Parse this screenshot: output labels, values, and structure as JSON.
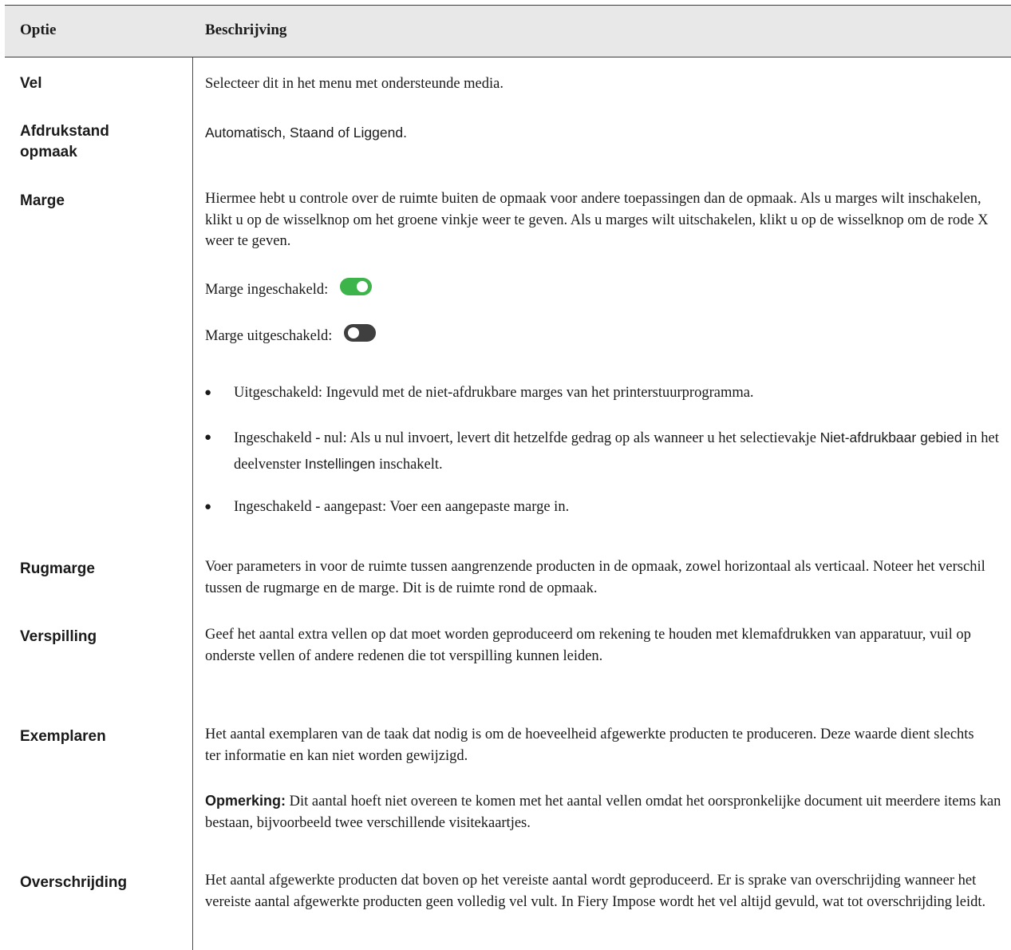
{
  "header": {
    "option": "Optie",
    "description": "Beschrijving"
  },
  "rows": {
    "vel": {
      "option": "Vel",
      "desc": "Selecteer dit in het menu met ondersteunde media."
    },
    "afdrukstand": {
      "option_line1": "Afdrukstand",
      "option_line2": "opmaak",
      "desc": "Automatisch, Staand of Liggend."
    },
    "marge": {
      "option": "Marge",
      "desc": "Hiermee hebt u controle over de ruimte buiten de opmaak voor andere toepassingen dan de opmaak. Als u marges wilt inschakelen, klikt u op de wisselknop om het groene vinkje weer te geven. Als u marges wilt uitschakelen, klikt u op de wisselknop om de rode X weer te geven.",
      "enabled_label": "Marge ingeschakeld:",
      "disabled_label": "Marge uitgeschakeld:",
      "bullet1": "Uitgeschakeld: Ingevuld met de niet-afdrukbare marges van het printerstuurprogramma.",
      "bullet2_a": "Ingeschakeld - nul: Als u nul invoert, levert dit hetzelfde gedrag op als wanneer u het selectievakje ",
      "bullet2_ui1": "Niet-afdrukbaar gebied",
      "bullet2_b": " in het deelvenster ",
      "bullet2_ui2": "Instellingen",
      "bullet2_c": " inschakelt.",
      "bullet3": "Ingeschakeld - aangepast: Voer een aangepaste marge in.",
      "bullet_symbol": "●"
    },
    "rugmarge": {
      "option": "Rugmarge",
      "desc": "Voer parameters in voor de ruimte tussen aangrenzende producten in de opmaak, zowel horizontaal als verticaal. Noteer het verschil tussen de rugmarge en de marge. Dit is de ruimte rond de opmaak."
    },
    "verspilling": {
      "option": "Verspilling",
      "desc": "Geef het aantal extra vellen op dat moet worden geproduceerd om rekening te houden met klemafdrukken van apparatuur, vuil op onderste vellen of andere redenen die tot verspilling kunnen leiden."
    },
    "exemplaren": {
      "option": "Exemplaren",
      "desc": "Het aantal exemplaren van de taak dat nodig is om de hoeveelheid afgewerkte producten te produceren. Deze waarde dient slechts ter informatie en kan niet worden gewijzigd.",
      "note_label": "Opmerking:",
      "note_text": " Dit aantal hoeft niet overeen te komen met het aantal vellen omdat het oorspronkelijke document uit meerdere items kan bestaan, bijvoorbeeld twee verschillende visitekaartjes."
    },
    "overschrijding": {
      "option": "Overschrijding",
      "desc": "Het aantal afgewerkte producten dat boven op het vereiste aantal wordt geproduceerd. Er is sprake van overschrijding wanneer het vereiste aantal afgewerkte producten geen volledig vel vult. In Fiery Impose wordt het vel altijd gevuld, wat tot overschrijding leidt."
    }
  },
  "toggles": {
    "enabled_state": "on",
    "disabled_state": "off",
    "on_color": "#3cb44a",
    "off_color": "#3f3f3f"
  }
}
